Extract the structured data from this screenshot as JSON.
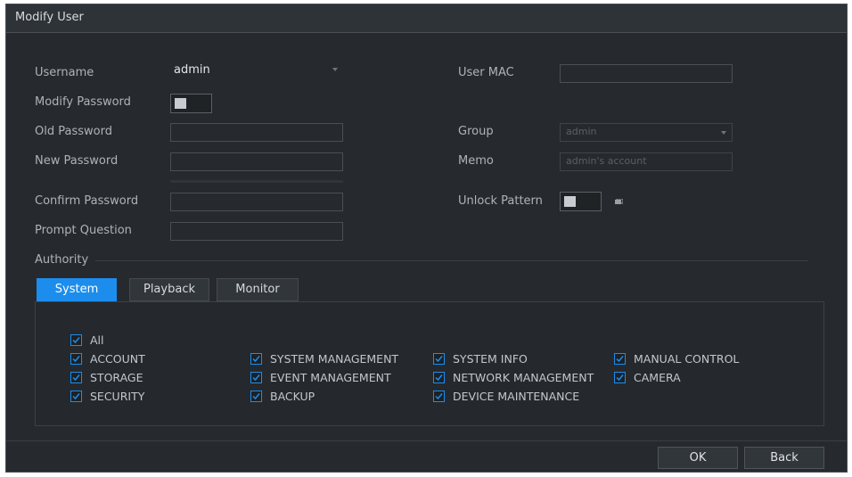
{
  "dialog": {
    "title": "Modify User"
  },
  "form": {
    "username_label": "Username",
    "username_value": "admin",
    "modify_password_label": "Modify Password",
    "old_password_label": "Old Password",
    "new_password_label": "New Password",
    "confirm_password_label": "Confirm Password",
    "prompt_question_label": "Prompt Question",
    "user_mac_label": "User MAC",
    "group_label": "Group",
    "group_value": "admin",
    "memo_label": "Memo",
    "memo_value": "admin's account",
    "unlock_pattern_label": "Unlock Pattern"
  },
  "authority": {
    "label": "Authority",
    "tabs": [
      {
        "label": "System",
        "active": true
      },
      {
        "label": "Playback",
        "active": false
      },
      {
        "label": "Monitor",
        "active": false
      }
    ],
    "permissions": {
      "all": {
        "label": "All",
        "checked": true
      },
      "col1": [
        {
          "label": "ACCOUNT",
          "checked": true
        },
        {
          "label": "STORAGE",
          "checked": true
        },
        {
          "label": "SECURITY",
          "checked": true
        }
      ],
      "col2": [
        {
          "label": "SYSTEM MANAGEMENT",
          "checked": true
        },
        {
          "label": "EVENT MANAGEMENT",
          "checked": true
        },
        {
          "label": "BACKUP",
          "checked": true
        }
      ],
      "col3": [
        {
          "label": "SYSTEM INFO",
          "checked": true
        },
        {
          "label": "NETWORK MANAGEMENT",
          "checked": true
        },
        {
          "label": "DEVICE MAINTENANCE",
          "checked": true
        }
      ],
      "col4": [
        {
          "label": "MANUAL CONTROL",
          "checked": true
        },
        {
          "label": "CAMERA",
          "checked": true
        }
      ]
    }
  },
  "buttons": {
    "ok": "OK",
    "back": "Back"
  },
  "colors": {
    "accent": "#1c8ded",
    "background": "#262a2e",
    "border": "#4a4f55"
  },
  "icons": {
    "dropdown": "chevron-down-icon",
    "checkbox": "check-icon",
    "pattern": "pattern-icon"
  }
}
